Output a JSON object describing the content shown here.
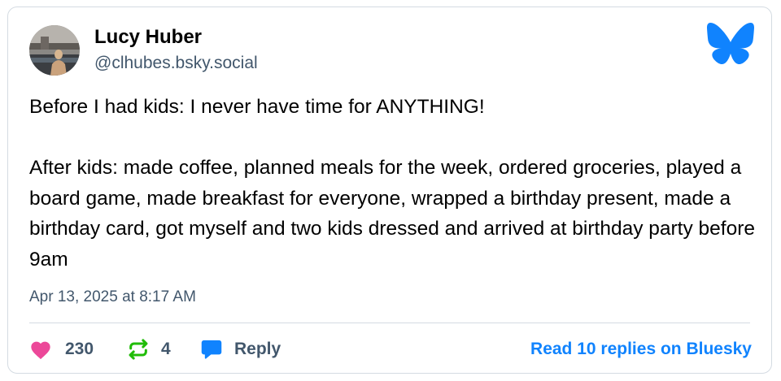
{
  "post": {
    "author": {
      "display_name": "Lucy Huber",
      "handle": "@clhubes.bsky.social"
    },
    "text": "Before I had kids: I never have time for ANYTHING!\n\nAfter kids: made coffee, planned meals for the week, ordered groceries, played a board game, made breakfast for everyone, wrapped a birthday present, made a birthday card, got myself and two kids dressed and arrived at birthday party before 9am",
    "timestamp": "Apr 13, 2025 at 8:17 AM"
  },
  "actions": {
    "likes": "230",
    "reposts": "4",
    "reply_label": "Reply",
    "read_replies_label": "Read 10 replies on Bluesky"
  },
  "icons": {
    "logo": "bluesky-butterfly-icon",
    "like": "heart-icon",
    "repost": "repost-icon",
    "reply": "speech-bubble-icon"
  },
  "colors": {
    "brand_blue": "#1083fe",
    "like_pink": "#ec4899",
    "repost_green": "#20bc07",
    "secondary_text": "#42576c",
    "border": "#d4dbe2"
  }
}
